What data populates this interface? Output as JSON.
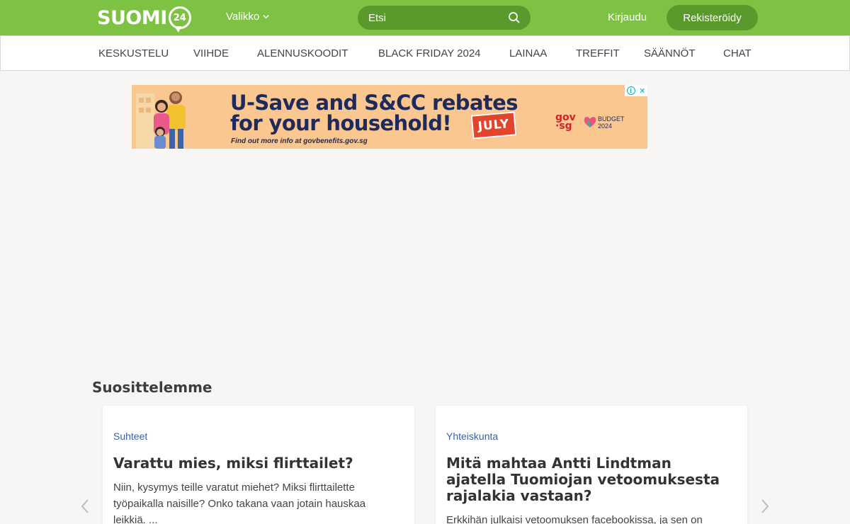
{
  "header": {
    "logo_text": "SUOMI",
    "logo_number": "24",
    "menu_label": "Valikko",
    "search_placeholder": "Etsi",
    "login_label": "Kirjaudu",
    "register_label": "Rekisteröidy",
    "accent_color": "#7dc242",
    "accent_dark": "#5a9a2d"
  },
  "nav": {
    "items": [
      "KESKUSTELU",
      "VIIHDE",
      "ALENNUSKOODIT",
      "BLACK FRIDAY 2024",
      "LAINAA",
      "TREFFIT",
      "SÄÄNNÖT",
      "CHAT"
    ]
  },
  "ad": {
    "headline1": "U-Save and S&CC rebates",
    "headline2": "for your household!",
    "badge": "JULY",
    "subtext": "Find out more info at govbenefits.gov.sg",
    "gov_logo": "gov\n·sg",
    "budget_logo": "BUDGET\n2024",
    "info_icon": "i",
    "close_icon": "✕"
  },
  "recommended": {
    "heading": "Suosittelemme",
    "cards": [
      {
        "category": "Suhteet",
        "title": "Varattu mies, miksi flirttailet?",
        "excerpt": "Niin, kysymys teille varatut miehet? Miksi flirttailette työpaikalla naisille? Onko takana vaan jotain hauskaa leikkiä. ..."
      },
      {
        "category": "Yhteiskunta",
        "title": "Mitä mahtaa Antti Lindtman ajatella Tuomiojan vetoomuksesta rajalakia vastaan?",
        "excerpt": "Erkkihän julkaisi vetoomuksen facebookissa, ja sen on"
      }
    ]
  }
}
